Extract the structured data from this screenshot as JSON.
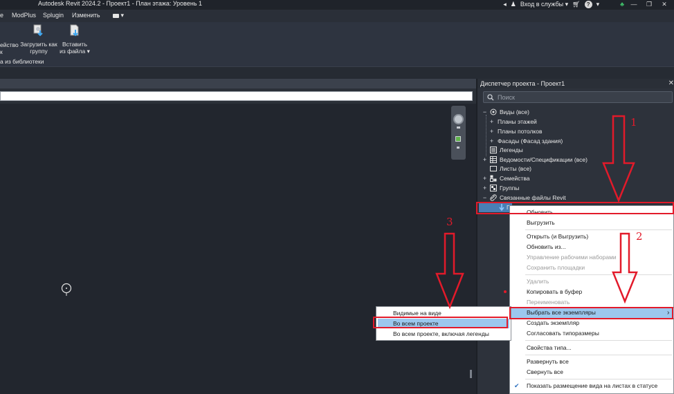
{
  "window": {
    "title": "Autodesk Revit 2024.2 - Проект1 - План этажа: Уровень 1",
    "signin": "Вход в службы",
    "minimize": "—",
    "restore": "❐",
    "close": "✕"
  },
  "menu": {
    "items": [
      "ModPlus",
      "Splugin",
      "Изменить"
    ]
  },
  "ribbon": {
    "partial_label_line1": "ейство",
    "partial_label_line2": "к",
    "load_group_line1": "Загрузить как",
    "load_group_line2": "группу",
    "insert_line1": "Вставить",
    "insert_line2": "из файла",
    "panel_label": "а из библиотеки"
  },
  "project_browser": {
    "title": "Диспетчер проекта - Проект1",
    "search_placeholder": "Поиск",
    "close": "✕",
    "tree": {
      "views": "Виды (все)",
      "floor_plans": "Планы этажей",
      "ceiling_plans": "Планы потолков",
      "elevations": "Фасады (Фасад здания)",
      "legends": "Легенды",
      "schedules": "Ведомости/Спецификации (все)",
      "sheets": "Листы (все)",
      "families": "Семейства",
      "groups": "Группы",
      "linked": "Связанные файлы Revit",
      "linked_item": "П"
    }
  },
  "context_menu": {
    "items": [
      {
        "label": "Обновить",
        "disabled": false
      },
      {
        "label": "Выгрузить",
        "disabled": false
      },
      {
        "label": "Открыть (и Выгрузить)",
        "disabled": false
      },
      {
        "label": "Обновить из...",
        "disabled": false
      },
      {
        "label": "Управление рабочими наборами",
        "disabled": true
      },
      {
        "label": "Сохранить площадки",
        "disabled": true
      },
      {
        "label": "Удалить",
        "disabled": true
      },
      {
        "label": "Копировать в буфер",
        "disabled": false
      },
      {
        "label": "Переименовать",
        "disabled": true
      },
      {
        "label": "Выбрать все экземпляры",
        "disabled": false
      },
      {
        "label": "Создать экземпляр",
        "disabled": false
      },
      {
        "label": "Согласовать типоразмеры",
        "disabled": false
      },
      {
        "label": "Свойства типа...",
        "disabled": false
      },
      {
        "label": "Развернуть все",
        "disabled": false
      },
      {
        "label": "Свернуть все",
        "disabled": false
      },
      {
        "label": "Показать размещение вида на листах в статусе",
        "disabled": false
      }
    ],
    "submenu_arrow": "›",
    "checkmark": "✔"
  },
  "submenu": {
    "items": [
      "Видимые на виде",
      "Во всем проекте",
      "Во всем проекте, включая легенды"
    ]
  },
  "annotations": {
    "step1": "1",
    "step2": "2",
    "step3": "3"
  },
  "colors": {
    "highlight": "#9cc8ee",
    "annotation_red": "#e21a2a",
    "panel_dark": "#2d323b"
  }
}
